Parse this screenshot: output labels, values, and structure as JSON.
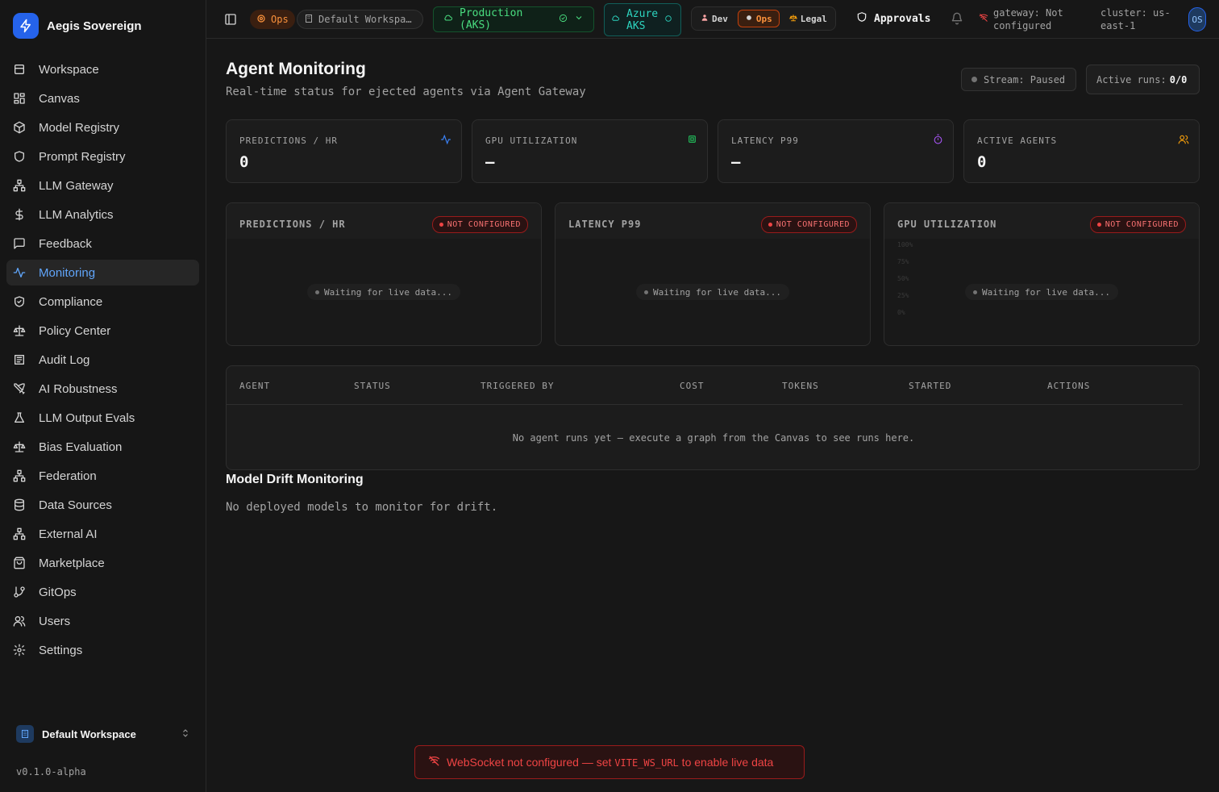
{
  "app": {
    "name": "Aegis Sovereign",
    "version": "v0.1.0-alpha"
  },
  "sidebar": {
    "items": [
      {
        "label": "Workspace",
        "icon": "workspace-icon"
      },
      {
        "label": "Canvas",
        "icon": "canvas-icon"
      },
      {
        "label": "Model Registry",
        "icon": "cube-icon"
      },
      {
        "label": "Prompt Registry",
        "icon": "shield-icon"
      },
      {
        "label": "LLM Gateway",
        "icon": "network-icon"
      },
      {
        "label": "LLM Analytics",
        "icon": "dollar-icon"
      },
      {
        "label": "Feedback",
        "icon": "message-icon"
      },
      {
        "label": "Monitoring",
        "icon": "activity-icon",
        "active": true
      },
      {
        "label": "Compliance",
        "icon": "shield-check-icon"
      },
      {
        "label": "Policy Center",
        "icon": "scale-icon"
      },
      {
        "label": "Audit Log",
        "icon": "log-icon"
      },
      {
        "label": "AI Robustness",
        "icon": "swords-icon"
      },
      {
        "label": "LLM Output Evals",
        "icon": "flask-icon"
      },
      {
        "label": "Bias Evaluation",
        "icon": "scale-icon"
      },
      {
        "label": "Federation",
        "icon": "network-icon"
      },
      {
        "label": "Data Sources",
        "icon": "database-icon"
      },
      {
        "label": "External AI",
        "icon": "network-icon"
      },
      {
        "label": "Marketplace",
        "icon": "bag-icon"
      },
      {
        "label": "GitOps",
        "icon": "git-branch-icon"
      },
      {
        "label": "Users",
        "icon": "users-icon"
      },
      {
        "label": "Settings",
        "icon": "gear-icon"
      }
    ],
    "workspace_switcher": "Default Workspace"
  },
  "topbar": {
    "persona_chip": "Ops",
    "workspace_select": "Default Workspa…",
    "environment": "Production (AKS)",
    "cloud_line1": "Azure",
    "cloud_line2": "AKS",
    "personas": [
      "Dev",
      "Ops",
      "Legal"
    ],
    "approvals": "Approvals",
    "gateway_line1": "gateway: Not",
    "gateway_line2": "configured",
    "cluster_line1": "cluster: us-",
    "cluster_line2": "east-1",
    "avatar_initials": "OS"
  },
  "main": {
    "title": "Agent Monitoring",
    "subtitle": "Real-time status for ejected agents via Agent Gateway",
    "stream_status": "Stream: Paused",
    "active_runs_label": "Active runs:",
    "active_runs_value": "0/0",
    "kpis": [
      {
        "label": "PREDICTIONS / HR",
        "value": "0",
        "icon": "activity-icon",
        "color": "#3b82f6"
      },
      {
        "label": "GPU UTILIZATION",
        "value": "—",
        "icon": "cpu-icon",
        "color": "#22c55e"
      },
      {
        "label": "LATENCY P99",
        "value": "—",
        "icon": "timer-icon",
        "color": "#a855f7"
      },
      {
        "label": "ACTIVE AGENTS",
        "value": "0",
        "icon": "users-icon",
        "color": "#f59e0b"
      }
    ],
    "charts": [
      {
        "title": "PREDICTIONS / HR",
        "badge": "NOT CONFIGURED",
        "waiting": "Waiting for live data..."
      },
      {
        "title": "LATENCY P99",
        "badge": "NOT CONFIGURED",
        "waiting": "Waiting for live data..."
      },
      {
        "title": "GPU UTILIZATION",
        "badge": "NOT CONFIGURED",
        "waiting": "Waiting for live data...",
        "yticks": [
          "100%",
          "75%",
          "50%",
          "25%",
          "0%"
        ]
      }
    ],
    "table": {
      "columns": [
        "AGENT",
        "STATUS",
        "TRIGGERED BY",
        "COST",
        "TOKENS",
        "STARTED",
        "ACTIONS"
      ],
      "empty": "No agent runs yet — execute a graph from the Canvas to see runs here."
    },
    "drift": {
      "title": "Model Drift Monitoring",
      "empty": "No deployed models to monitor for drift."
    }
  },
  "toast": {
    "prefix": "WebSocket not configured — set ",
    "code": "VITE_WS_URL",
    "suffix": " to enable live data"
  }
}
